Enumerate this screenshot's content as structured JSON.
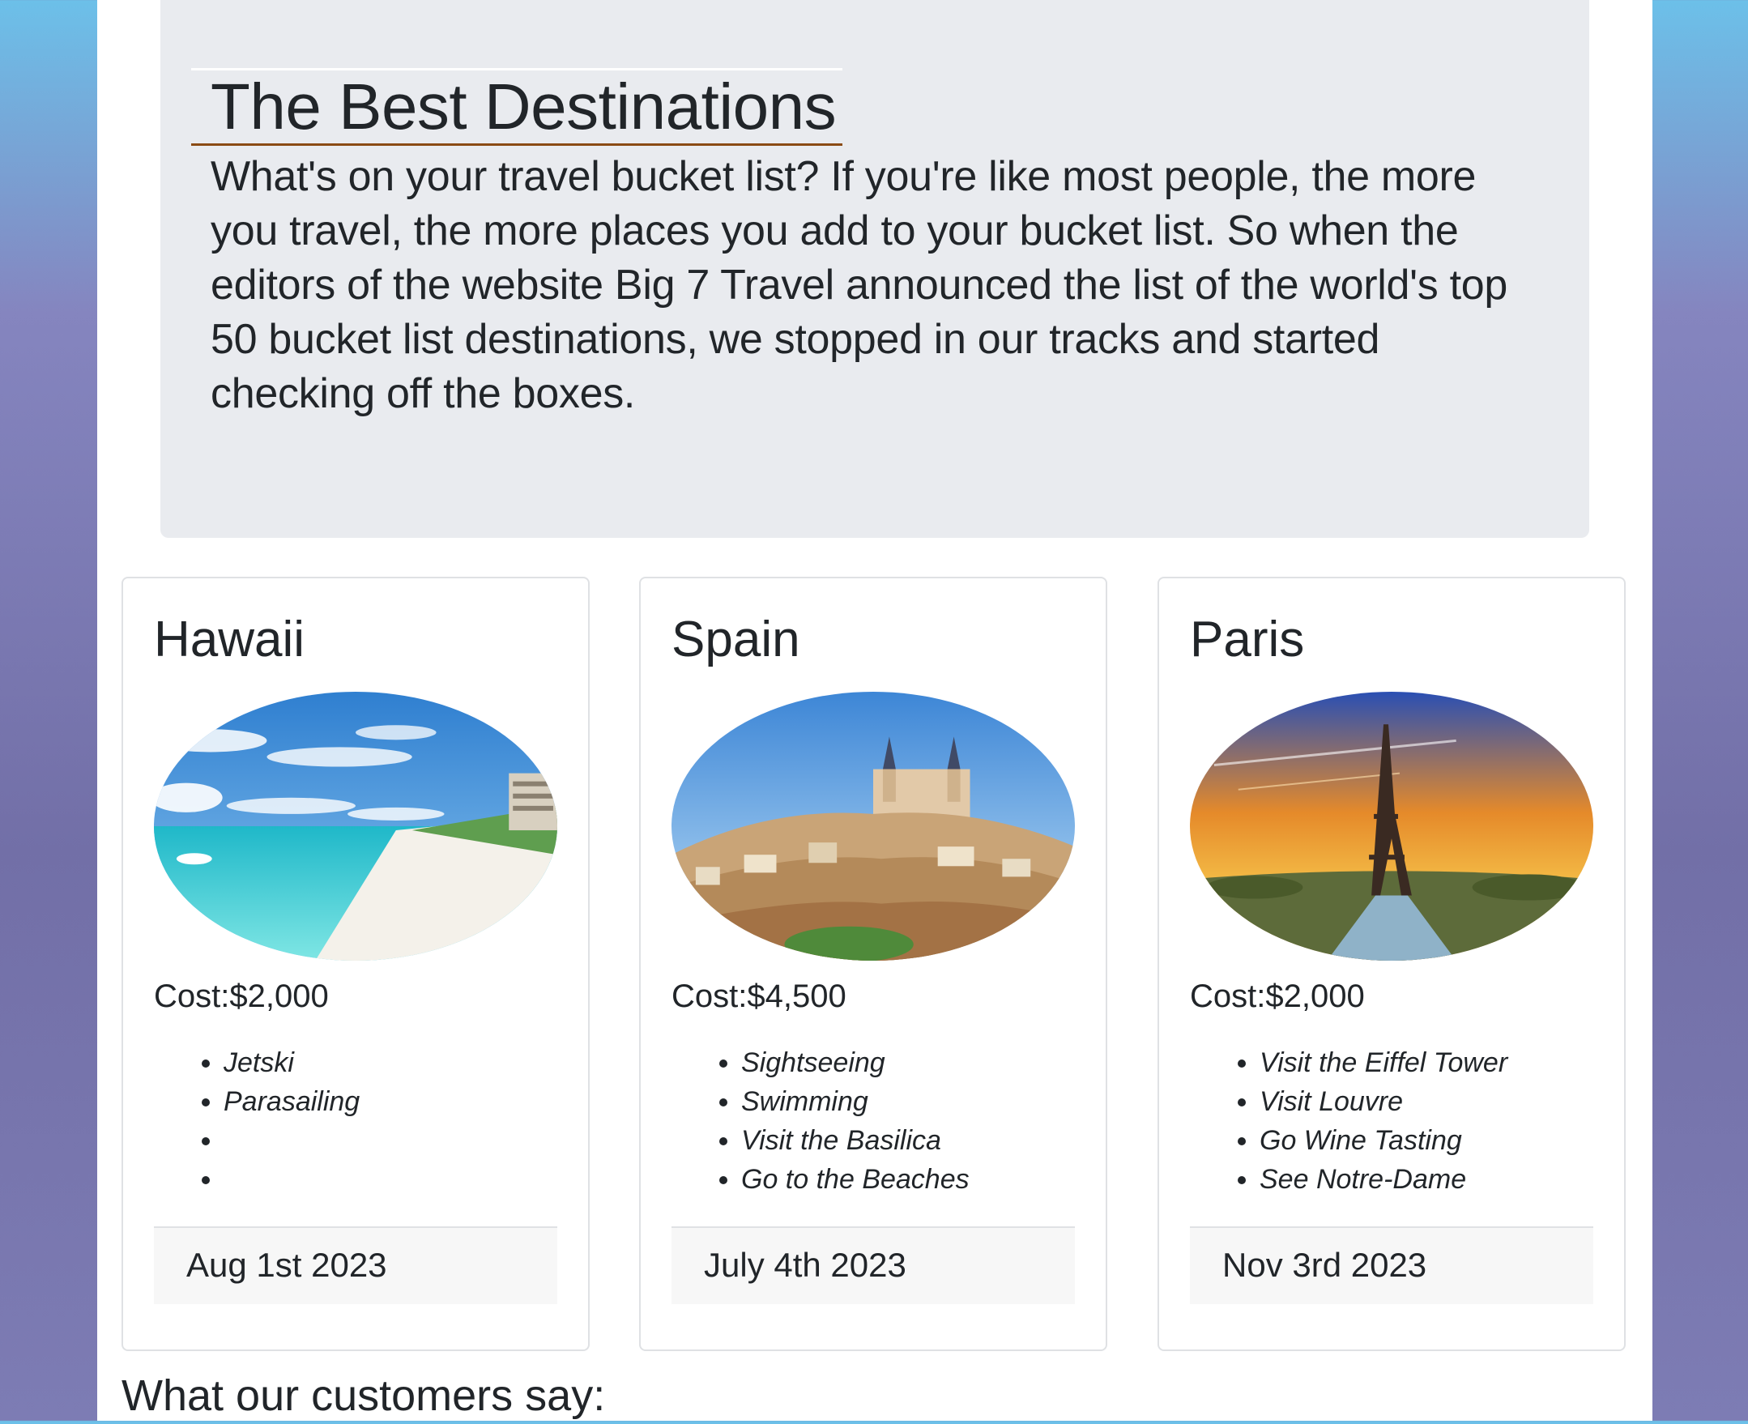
{
  "hero": {
    "title": "The Best Destinations",
    "text": "What's on your travel bucket list? If you're like most people, the more you travel, the more places you add to your bucket list. So when the editors of the website Big 7 Travel announced the list of the world's top 50 bucket list destinations, we stopped in our tracks and started checking off the boxes."
  },
  "cards": [
    {
      "title": "Hawaii",
      "image_icon": "beach-photo",
      "cost": "Cost:$2,000",
      "activities": [
        "Jetski",
        "Parasailing",
        "",
        ""
      ],
      "date": "Aug 1st 2023"
    },
    {
      "title": "Spain",
      "image_icon": "city-photo",
      "cost": "Cost:$4,500",
      "activities": [
        "Sightseeing",
        "Swimming",
        "Visit the Basilica",
        "Go to the Beaches"
      ],
      "date": "July 4th 2023"
    },
    {
      "title": "Paris",
      "image_icon": "eiffel-tower-photo",
      "cost": "Cost:$2,000",
      "activities": [
        "Visit the Eiffel Tower",
        "Visit Louvre",
        "Go Wine Tasting",
        "See Notre-Dame"
      ],
      "date": "Nov 3rd 2023"
    }
  ],
  "reviews": {
    "heading": "What our customers say:"
  }
}
